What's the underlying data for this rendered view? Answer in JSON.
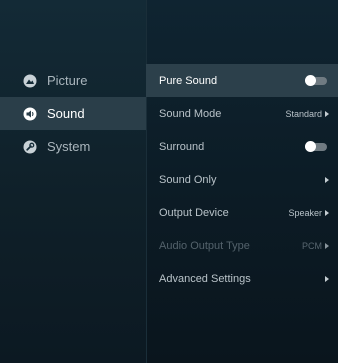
{
  "nav": {
    "items": [
      {
        "label": "Picture",
        "icon": "picture-icon"
      },
      {
        "label": "Sound",
        "icon": "sound-icon",
        "active": true
      },
      {
        "label": "System",
        "icon": "system-icon"
      }
    ]
  },
  "menu": {
    "items": [
      {
        "label": "Pure Sound",
        "control": "toggle",
        "state": "off"
      },
      {
        "label": "Sound Mode",
        "value": "Standard"
      },
      {
        "label": "Surround",
        "control": "toggle",
        "state": "off"
      },
      {
        "label": "Sound Only",
        "value": ""
      },
      {
        "label": "Output Device",
        "value": "Speaker"
      },
      {
        "label": "Audio Output Type",
        "value": "PCM",
        "disabled": true
      },
      {
        "label": "Advanced Settings",
        "value": ""
      }
    ]
  },
  "colors": {
    "active_row_bg": "#2c404b",
    "active_nav_bg": "#2a3e49",
    "text_primary": "#ffffff",
    "text_secondary": "#b9c3c9",
    "text_disabled": "#53626b"
  }
}
